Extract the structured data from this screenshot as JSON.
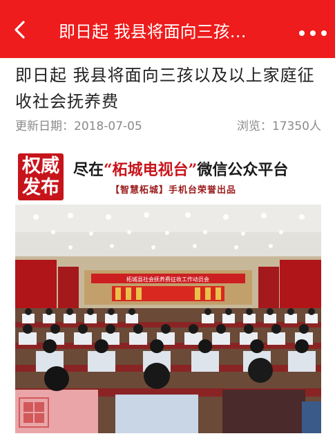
{
  "header": {
    "title": "即日起 我县将面向三孩…",
    "back_icon": "back-chevron-icon",
    "more_icon": "more-dots-icon",
    "background_color": "#ee1c1c"
  },
  "article": {
    "title": "即日起 我县将面向三孩以及以上家庭征收社会抚养费",
    "date": "更新日期：2018-07-05",
    "views": "浏览：17350人"
  },
  "banner": {
    "seal_line1": "权威",
    "seal_line2": "发布",
    "text_prefix": "尽在",
    "text_accent": "“柘城电视台”",
    "text_suffix": "微信公众平台",
    "subtitle": "【智慧柘城】手机台荣誉出品"
  },
  "photo": {
    "stage_banner_text": "柘城县社会抚养费征收工作动员会",
    "watermark_icon": "red-seal-watermark-icon"
  }
}
